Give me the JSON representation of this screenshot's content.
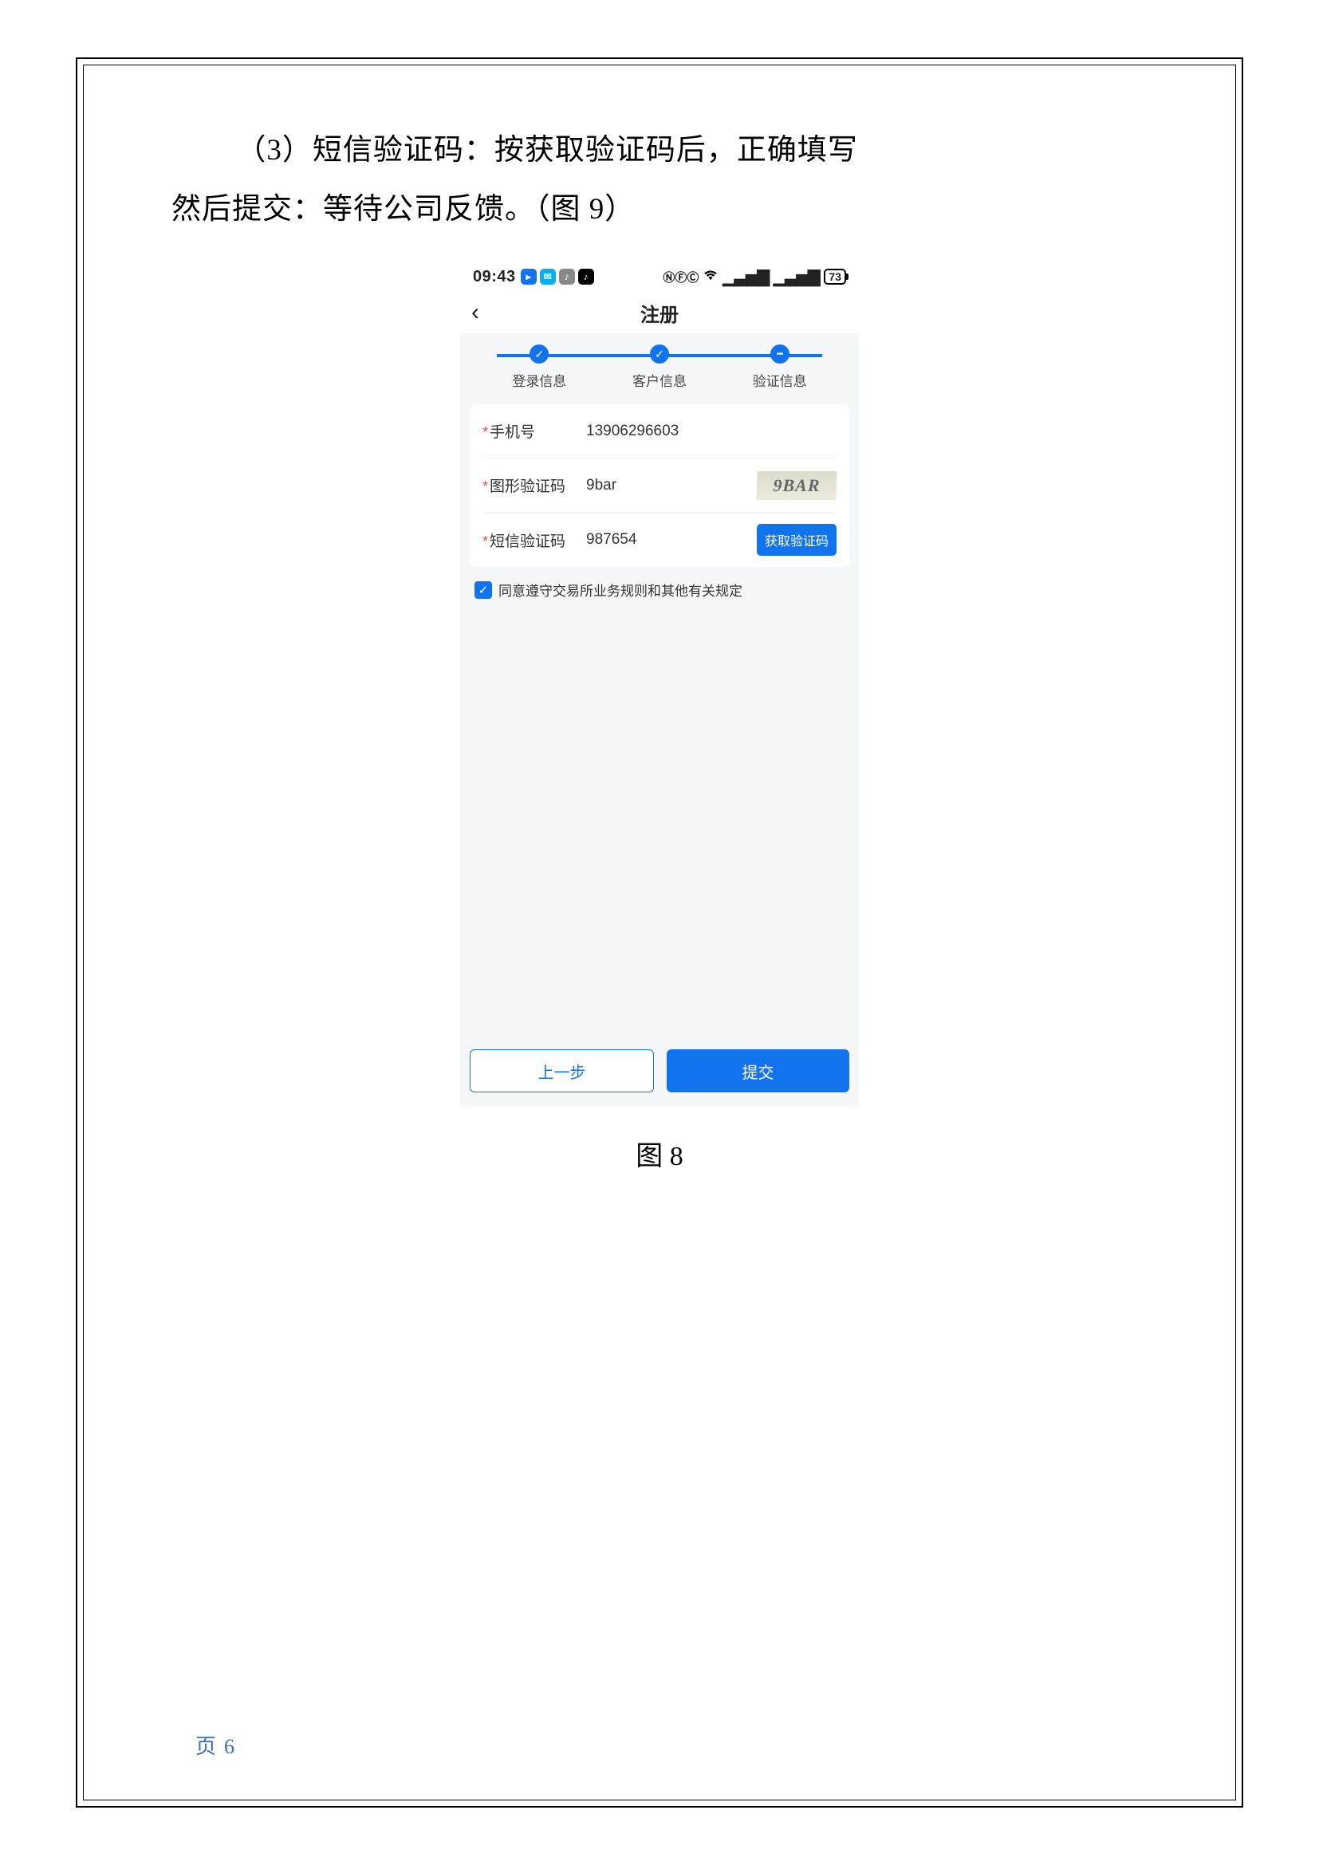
{
  "body": {
    "line1": "（3）短信验证码：按获取验证码后，正确填写",
    "line2": "然后提交：等待公司反馈。（图 9）"
  },
  "phone": {
    "statusbar": {
      "time": "09:43",
      "battery": "73"
    },
    "navbar": {
      "back_glyph": "‹",
      "title": "注册"
    },
    "progress": {
      "step1": "登录信息",
      "step2": "客户信息",
      "step3": "验证信息",
      "check_glyph": "✓"
    },
    "form": {
      "phone_label": "手机号",
      "phone_value": "13906296603",
      "img_code_label": "图形验证码",
      "img_code_value": "9bar",
      "captcha_text": "9BAR",
      "sms_code_label": "短信验证码",
      "sms_code_value": "987654",
      "get_code_btn": "获取验证码"
    },
    "agree": {
      "check_glyph": "✓",
      "text": "同意遵守交易所业务规则和其他有关规定"
    },
    "footer": {
      "prev": "上一步",
      "submit": "提交"
    }
  },
  "caption": "图 8",
  "page_footer": {
    "label": "页",
    "num": "6"
  }
}
